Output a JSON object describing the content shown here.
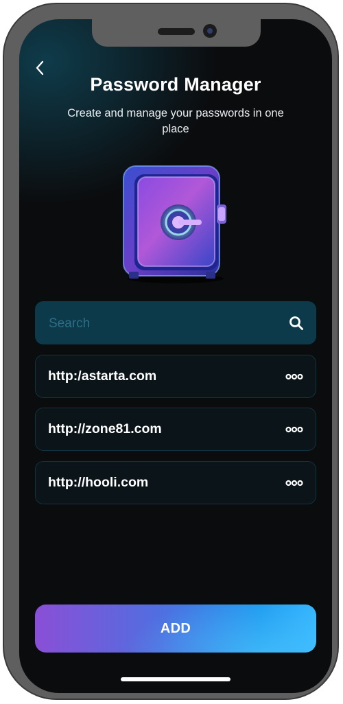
{
  "header": {
    "back_icon": "chevron-left-icon",
    "title": "Password Manager",
    "subtitle": "Create and manage your passwords in one place"
  },
  "hero": {
    "illustration": "safe-illustration"
  },
  "search": {
    "placeholder": "Search",
    "value": "",
    "icon": "search-icon"
  },
  "passwords": {
    "items": [
      {
        "url": "http:/astarta.com",
        "more_icon": "more-icon"
      },
      {
        "url": "http://zone81.com",
        "more_icon": "more-icon"
      },
      {
        "url": "http://hooli.com",
        "more_icon": "more-icon"
      }
    ]
  },
  "actions": {
    "add_label": "ADD"
  },
  "colors": {
    "background": "#0b0c0e",
    "search_background": "#0d3a4a",
    "item_border": "#123340",
    "button_gradient_start": "#8a4fd6",
    "button_gradient_end": "#35b5ff"
  }
}
